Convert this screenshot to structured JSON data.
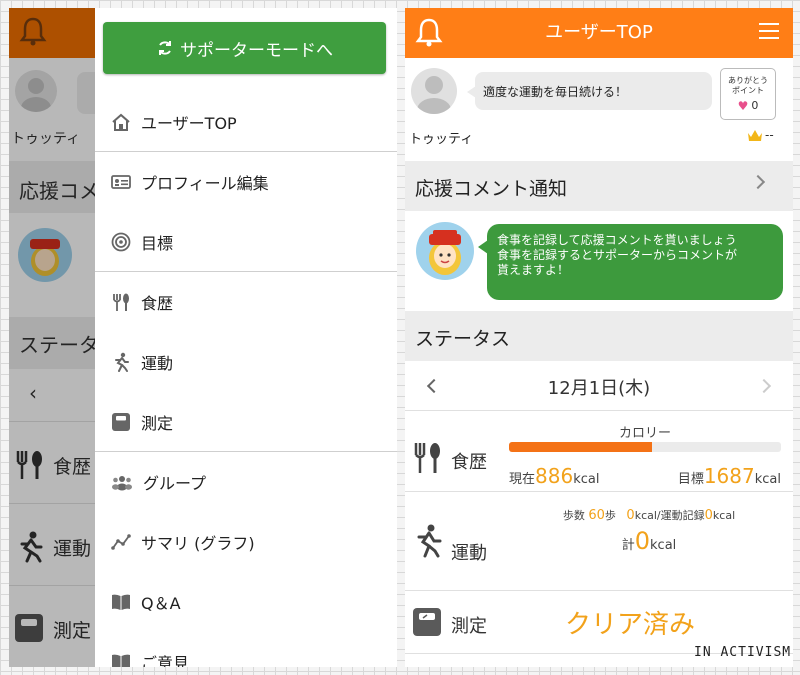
{
  "left": {
    "background": {
      "name": "トゥッティ",
      "section_support": "応援コメ",
      "section_status": "ステータ",
      "date_prev": "‹",
      "row_meal": "食歴",
      "row_exercise": "運動",
      "row_measure": "測定"
    },
    "drawer": {
      "support_mode_label": "サポーターモードへ",
      "items": [
        {
          "label": "ユーザーTOP",
          "icon": "home-icon"
        },
        {
          "label": "プロフィール編集",
          "icon": "id-card-icon"
        },
        {
          "label": "目標",
          "icon": "target-icon"
        },
        {
          "label": "食歴",
          "icon": "fork-knife-icon"
        },
        {
          "label": "運動",
          "icon": "runner-icon"
        },
        {
          "label": "測定",
          "icon": "scale-icon"
        },
        {
          "label": "グループ",
          "icon": "group-icon"
        },
        {
          "label": "サマリ (グラフ)",
          "icon": "graph-icon"
        },
        {
          "label": "Q＆A",
          "icon": "book-icon"
        },
        {
          "label": "ご意見",
          "icon": "feedback-icon"
        }
      ]
    }
  },
  "right": {
    "header": {
      "title": "ユーザーTOP"
    },
    "profile": {
      "goal": "適度な運動を毎日続ける！",
      "thanks_line1": "ありがとう",
      "thanks_line2": "ポイント",
      "thanks_points": "0",
      "name": "トゥッティ",
      "rank": "--"
    },
    "support": {
      "title": "応援コメント通知",
      "message_line1": "食事を記録して応援コメントを貰いましょう",
      "message_line2": "食事を記録するとサポーターからコメントが",
      "message_line3": "貰えますよ！"
    },
    "status": {
      "title": "ステータス",
      "date": "12月1日(木)",
      "meal": {
        "label": "食歴",
        "calorie_label": "カロリー",
        "current_prefix": "現在",
        "current_value": "886",
        "current_unit": "kcal",
        "goal_prefix": "目標",
        "goal_value": "1687",
        "goal_unit": "kcal",
        "progress": 0.525
      },
      "exercise": {
        "label": "運動",
        "steps_prefix": "歩数",
        "steps_value": "60",
        "steps_unit": "歩",
        "record_value": "0",
        "record_text": "kcal/運動記録",
        "record2_value": "0",
        "record2_unit": "kcal",
        "total_prefix": "計",
        "total_value": "0",
        "total_unit": "kcal"
      },
      "measure": {
        "label": "測定",
        "status": "クリア済み"
      }
    }
  },
  "watermark": "IN ACTIVISM",
  "colors": {
    "header_orange": "#ff7e16",
    "support_green": "#3f9e3f",
    "value_yellow": "#f2a21b",
    "bar_fill": "#f47216"
  }
}
